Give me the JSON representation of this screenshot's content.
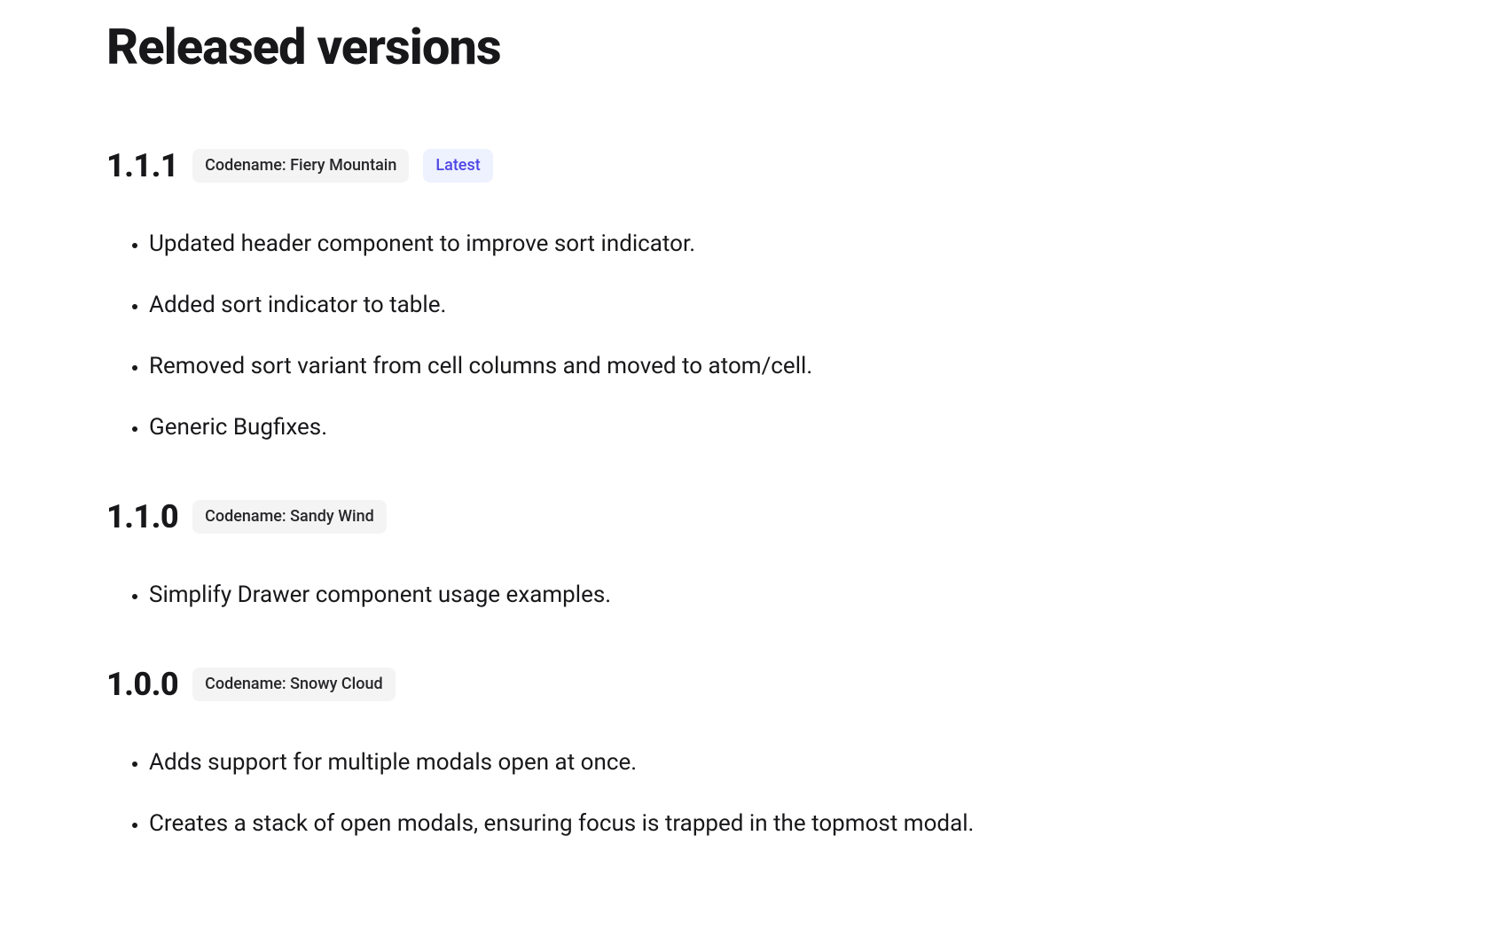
{
  "page": {
    "title": "Released versions",
    "latest_label": "Latest"
  },
  "versions": [
    {
      "number": "1.1.1",
      "codename": "Codename: Fiery Mountain",
      "is_latest": true,
      "notes": [
        "Updated header component to improve sort indicator.",
        "Added sort indicator to table.",
        "Removed sort variant from cell columns and moved to atom/cell.",
        "Generic Bugfixes."
      ]
    },
    {
      "number": "1.1.0",
      "codename": "Codename: Sandy Wind",
      "is_latest": false,
      "notes": [
        "Simplify Drawer component usage examples."
      ]
    },
    {
      "number": "1.0.0",
      "codename": "Codename: Snowy Cloud",
      "is_latest": false,
      "notes": [
        "Adds support for multiple modals open at once.",
        "Creates a stack of open modals, ensuring focus is trapped in the topmost modal."
      ]
    }
  ]
}
